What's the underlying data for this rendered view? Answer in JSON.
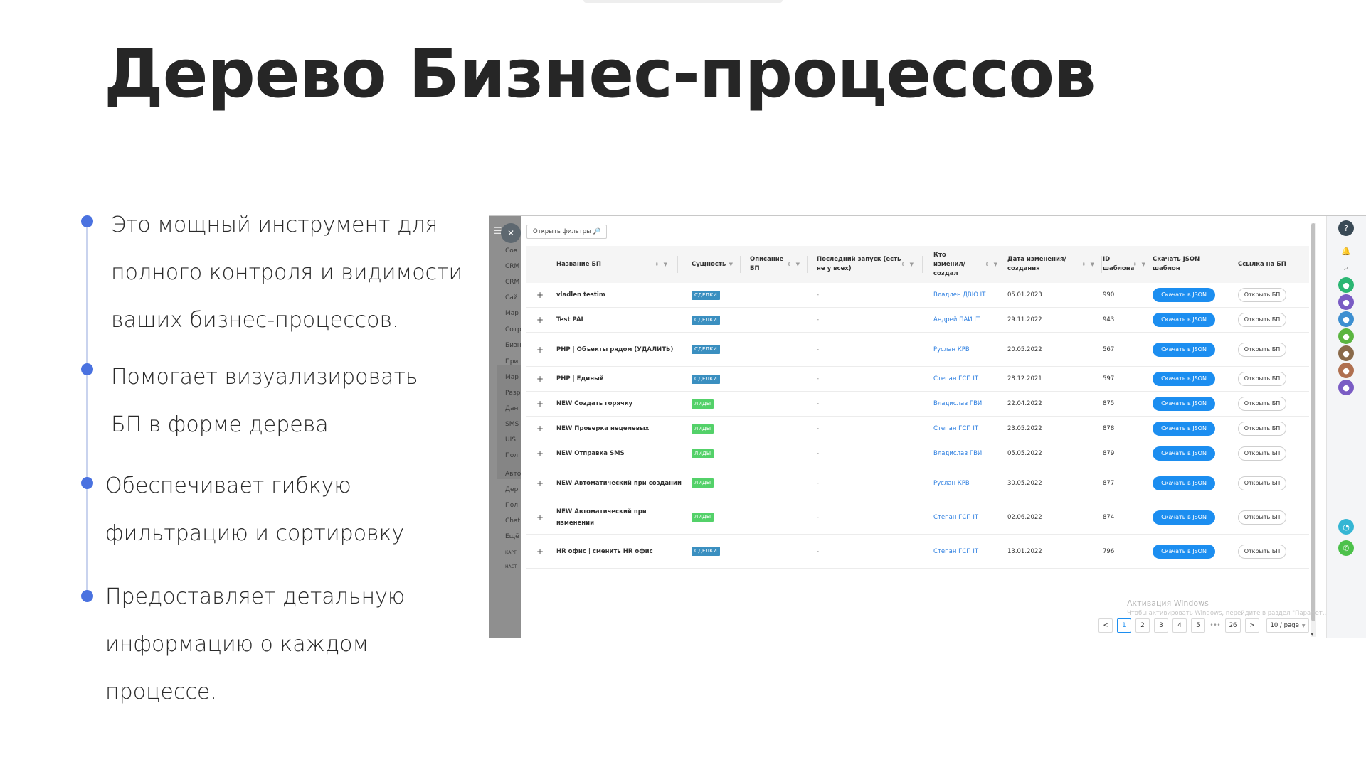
{
  "slide": {
    "title": "Дерево Бизнес-процессов",
    "bullets": [
      {
        "lines": [
          "Это мощный инструмент для",
          "полного контроля и видимости",
          "ваших бизнес-процессов."
        ]
      },
      {
        "lines": [
          "Помогает визуализировать",
          "БП в форме дерева"
        ]
      },
      {
        "lines": [
          "Обеспечивает гибкую",
          "фильтрацию и сортировку"
        ]
      },
      {
        "lines": [
          "Предоставляет детальную",
          "информацию о каждом",
          "процессе."
        ]
      }
    ],
    "accent_color": "#4a72e0"
  },
  "app": {
    "menu_icon": "☰",
    "close_icon": "✕",
    "sidebar_items": [
      "Сов",
      "CRM",
      "CRM",
      "Сай",
      "Мар",
      "Сотр",
      "Бизн",
      "При",
      "Мар",
      "Разр",
      "Дан",
      "SMS",
      "UIS",
      "Пол",
      "Авто",
      "Дер",
      "Пол",
      "Chat",
      "Ещё",
      "КАРТ",
      "НАСТ"
    ],
    "filter_button": "Открыть фильтры 🔎",
    "columns": [
      {
        "label": "Название БП"
      },
      {
        "label": "Сущность"
      },
      {
        "label": "Описание БП"
      },
      {
        "label": "Последний запуск (есть не у всех)"
      },
      {
        "label": "Кто изменил/ создал"
      },
      {
        "label": "Дата изменения/ создания"
      },
      {
        "label": "ID шаблона"
      },
      {
        "label": "Скачать JSON шаблон"
      },
      {
        "label": "Ссылка на БП"
      }
    ],
    "rows": [
      {
        "expand": "+",
        "name": "vladlen testim",
        "entity": "СДЕЛКИ",
        "entity_kind": "deal",
        "last_run": "-",
        "who": "Владлен ДВЮ IT",
        "date": "05.01.2023",
        "id": "990",
        "download": "Скачать в JSON",
        "open": "Открыть БП"
      },
      {
        "expand": "+",
        "name": "Test PAI",
        "entity": "СДЕЛКИ",
        "entity_kind": "deal",
        "last_run": "-",
        "who": "Андрей ПАИ IT",
        "date": "29.11.2022",
        "id": "943",
        "download": "Скачать в JSON",
        "open": "Открыть БП"
      },
      {
        "expand": "+",
        "name": "PHP | Объекты рядом (УДАЛИТЬ)",
        "entity": "СДЕЛКИ",
        "entity_kind": "deal",
        "last_run": "-",
        "who": "Руслан КРВ",
        "date": "20.05.2022",
        "id": "567",
        "download": "Скачать в JSON",
        "open": "Открыть БП"
      },
      {
        "expand": "+",
        "name": "PHP | Единый",
        "entity": "СДЕЛКИ",
        "entity_kind": "deal",
        "last_run": "-",
        "who": "Степан ГСП IT",
        "date": "28.12.2021",
        "id": "597",
        "download": "Скачать в JSON",
        "open": "Открыть БП"
      },
      {
        "expand": "+",
        "name": "NEW Создать горячку",
        "entity": "ЛИДЫ",
        "entity_kind": "lead",
        "last_run": "-",
        "who": "Владислав ГВИ",
        "date": "22.04.2022",
        "id": "875",
        "download": "Скачать в JSON",
        "open": "Открыть БП"
      },
      {
        "expand": "+",
        "name": "NEW Проверка нецелевых",
        "entity": "ЛИДЫ",
        "entity_kind": "lead",
        "last_run": "-",
        "who": "Степан ГСП IT",
        "date": "23.05.2022",
        "id": "878",
        "download": "Скачать в JSON",
        "open": "Открыть БП"
      },
      {
        "expand": "+",
        "name": "NEW Отправка SMS",
        "entity": "ЛИДЫ",
        "entity_kind": "lead",
        "last_run": "-",
        "who": "Владислав ГВИ",
        "date": "05.05.2022",
        "id": "879",
        "download": "Скачать в JSON",
        "open": "Открыть БП"
      },
      {
        "expand": "+",
        "name": "NEW Автоматический при создании",
        "entity": "ЛИДЫ",
        "entity_kind": "lead",
        "last_run": "-",
        "who": "Руслан КРВ",
        "date": "30.05.2022",
        "id": "877",
        "download": "Скачать в JSON",
        "open": "Открыть БП"
      },
      {
        "expand": "+",
        "name": "NEW Автоматический при изменении",
        "entity": "ЛИДЫ",
        "entity_kind": "lead",
        "last_run": "-",
        "who": "Степан ГСП IT",
        "date": "02.06.2022",
        "id": "874",
        "download": "Скачать в JSON",
        "open": "Открыть БП"
      },
      {
        "expand": "+",
        "name": "HR офис | сменить HR офис",
        "entity": "СДЕЛКИ",
        "entity_kind": "deal",
        "last_run": "-",
        "who": "Степан ГСП IT",
        "date": "13.01.2022",
        "id": "796",
        "download": "Скачать в JSON",
        "open": "Открыть БП"
      }
    ],
    "pagination": {
      "prev": "<",
      "pages": [
        "1",
        "2",
        "3",
        "4",
        "5"
      ],
      "ellipsis": "•••",
      "last": "26",
      "next": ">",
      "page_size": "10 / page",
      "current": "1"
    },
    "watermark": {
      "title": "Активация Windows",
      "subtitle": "Чтобы активировать Windows, перейдите в раздел \"Парамет...\""
    },
    "colors": {
      "tag_deal": "#3a8fc0",
      "tag_lead": "#53d169",
      "primary": "#1c8ef0",
      "link": "#2e7fe0"
    },
    "right_rail_icons": [
      "help-icon",
      "bell-icon",
      "search-icon",
      "user-avatar",
      "user-avatar",
      "user-avatar",
      "user-avatar",
      "user-photo",
      "user-photo",
      "user-avatar",
      "chat-icon",
      "phone-icon"
    ]
  }
}
